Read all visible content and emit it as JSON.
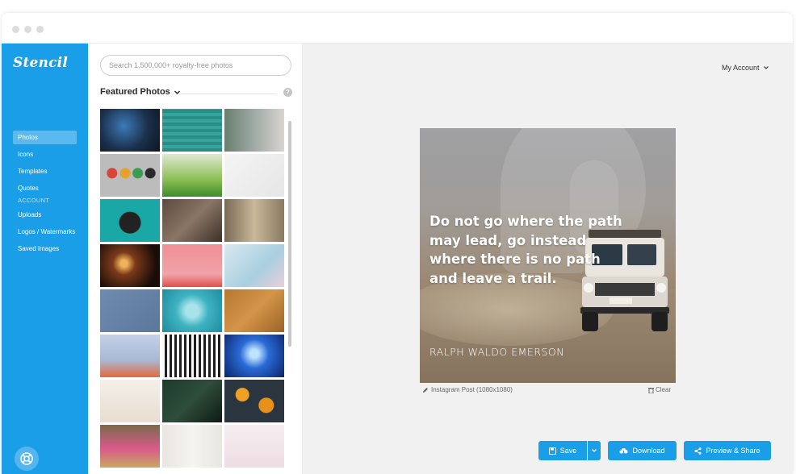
{
  "sidebar": {
    "logo": "Stencil",
    "nav": [
      {
        "label": "Photos",
        "active": true
      },
      {
        "label": "Icons",
        "active": false
      },
      {
        "label": "Templates",
        "active": false
      },
      {
        "label": "Quotes",
        "active": false
      }
    ],
    "account_heading": "ACCOUNT",
    "account_nav": [
      {
        "label": "Uploads"
      },
      {
        "label": "Logos / Watermarks"
      },
      {
        "label": "Saved Images"
      }
    ],
    "help_icon": "lifebuoy-icon"
  },
  "panel": {
    "search_placeholder": "Search 1,500,000+ royalty-free photos",
    "featured_label": "Featured Photos",
    "info_icon_glyph": "?"
  },
  "header": {
    "account_label": "My Account"
  },
  "canvas": {
    "quote": "Do not go where the path may lead, go instead where there is no path and leave a trail.",
    "author": "RALPH WALDO EMERSON",
    "caption": "Instagram Post (1080x1080)",
    "clear_label": "Clear"
  },
  "actions": {
    "save_label": "Save",
    "download_label": "Download",
    "preview_label": "Preview & Share"
  },
  "colors": {
    "brand": "#1b9ee8",
    "canvas_bg": "#f1f1f2"
  }
}
